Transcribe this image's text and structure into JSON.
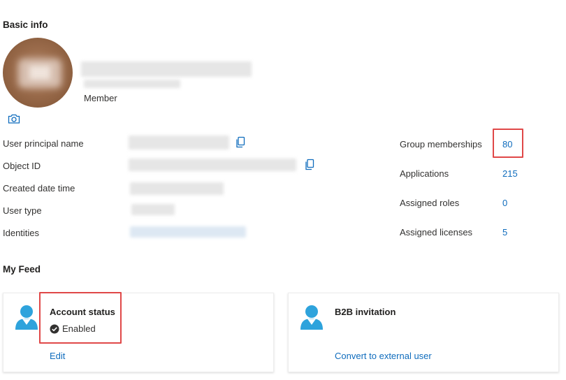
{
  "basic_info": {
    "title": "Basic info",
    "role": "Member"
  },
  "properties": [
    {
      "label": "User principal name",
      "has_copy": true
    },
    {
      "label": "Object ID",
      "has_copy": true
    },
    {
      "label": "Created date time",
      "has_copy": false
    },
    {
      "label": "User type",
      "has_copy": false
    },
    {
      "label": "Identities",
      "has_copy": false
    }
  ],
  "stats": [
    {
      "label": "Group memberships",
      "value": "80",
      "highlighted": true
    },
    {
      "label": "Applications",
      "value": "215",
      "highlighted": false
    },
    {
      "label": "Assigned roles",
      "value": "0",
      "highlighted": false
    },
    {
      "label": "Assigned licenses",
      "value": "5",
      "highlighted": false
    }
  ],
  "feed": {
    "title": "My Feed",
    "cards": [
      {
        "title": "Account status",
        "status": "Enabled",
        "link": "Edit"
      },
      {
        "title": "B2B invitation",
        "link": "Convert to external user"
      }
    ]
  },
  "colors": {
    "link_blue": "#0f6cbd",
    "highlight_red": "#e04848",
    "person_icon": "#2ea3dc"
  },
  "icons": [
    "camera-icon",
    "copy-icon",
    "person-icon",
    "check-circle-icon"
  ]
}
